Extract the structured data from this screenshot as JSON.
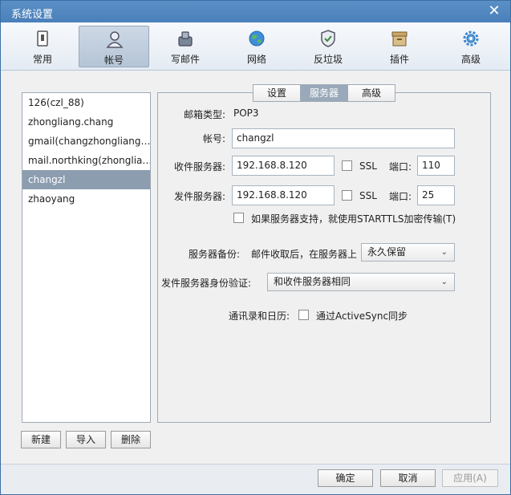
{
  "window": {
    "title": "系统设置",
    "close": "✕"
  },
  "toolbar": [
    {
      "label": "常用",
      "icon": "general-icon"
    },
    {
      "label": "帐号",
      "icon": "account-icon"
    },
    {
      "label": "写邮件",
      "icon": "compose-icon"
    },
    {
      "label": "网络",
      "icon": "network-icon"
    },
    {
      "label": "反垃圾",
      "icon": "antispam-icon"
    },
    {
      "label": "插件",
      "icon": "plugin-icon"
    },
    {
      "label": "高级",
      "icon": "advanced-icon"
    }
  ],
  "accounts": [
    "126(czl_88)",
    "zhongliang.chang",
    "gmail(changzhongliang…",
    "mail.northking(zhonglia…",
    "changzl",
    "zhaoyang"
  ],
  "account_buttons": {
    "new": "新建",
    "import": "导入",
    "delete": "删除"
  },
  "tabs": [
    "设置",
    "服务器",
    "高级"
  ],
  "form": {
    "mailbox_type_label": "邮箱类型:",
    "mailbox_type_value": "POP3",
    "account_label": "帐号:",
    "account_value": "changzl",
    "incoming_label": "收件服务器:",
    "incoming_value": "192.168.8.120",
    "incoming_ssl": "SSL",
    "incoming_port_label": "端口:",
    "incoming_port_value": "110",
    "outgoing_label": "发件服务器:",
    "outgoing_value": "192.168.8.120",
    "outgoing_ssl": "SSL",
    "outgoing_port_label": "端口:",
    "outgoing_port_value": "25",
    "starttls_label": "如果服务器支持，就使用STARTTLS加密传输(T)",
    "backup_label": "服务器备份:",
    "backup_desc": "邮件收取后，在服务器上",
    "backup_value": "永久保留",
    "auth_label": "发件服务器身份验证:",
    "auth_value": "和收件服务器相同",
    "sync_label": "通讯录和日历:",
    "sync_option": "通过ActiveSync同步"
  },
  "bottom": {
    "ok": "确定",
    "cancel": "取消",
    "apply": "应用(A)"
  }
}
